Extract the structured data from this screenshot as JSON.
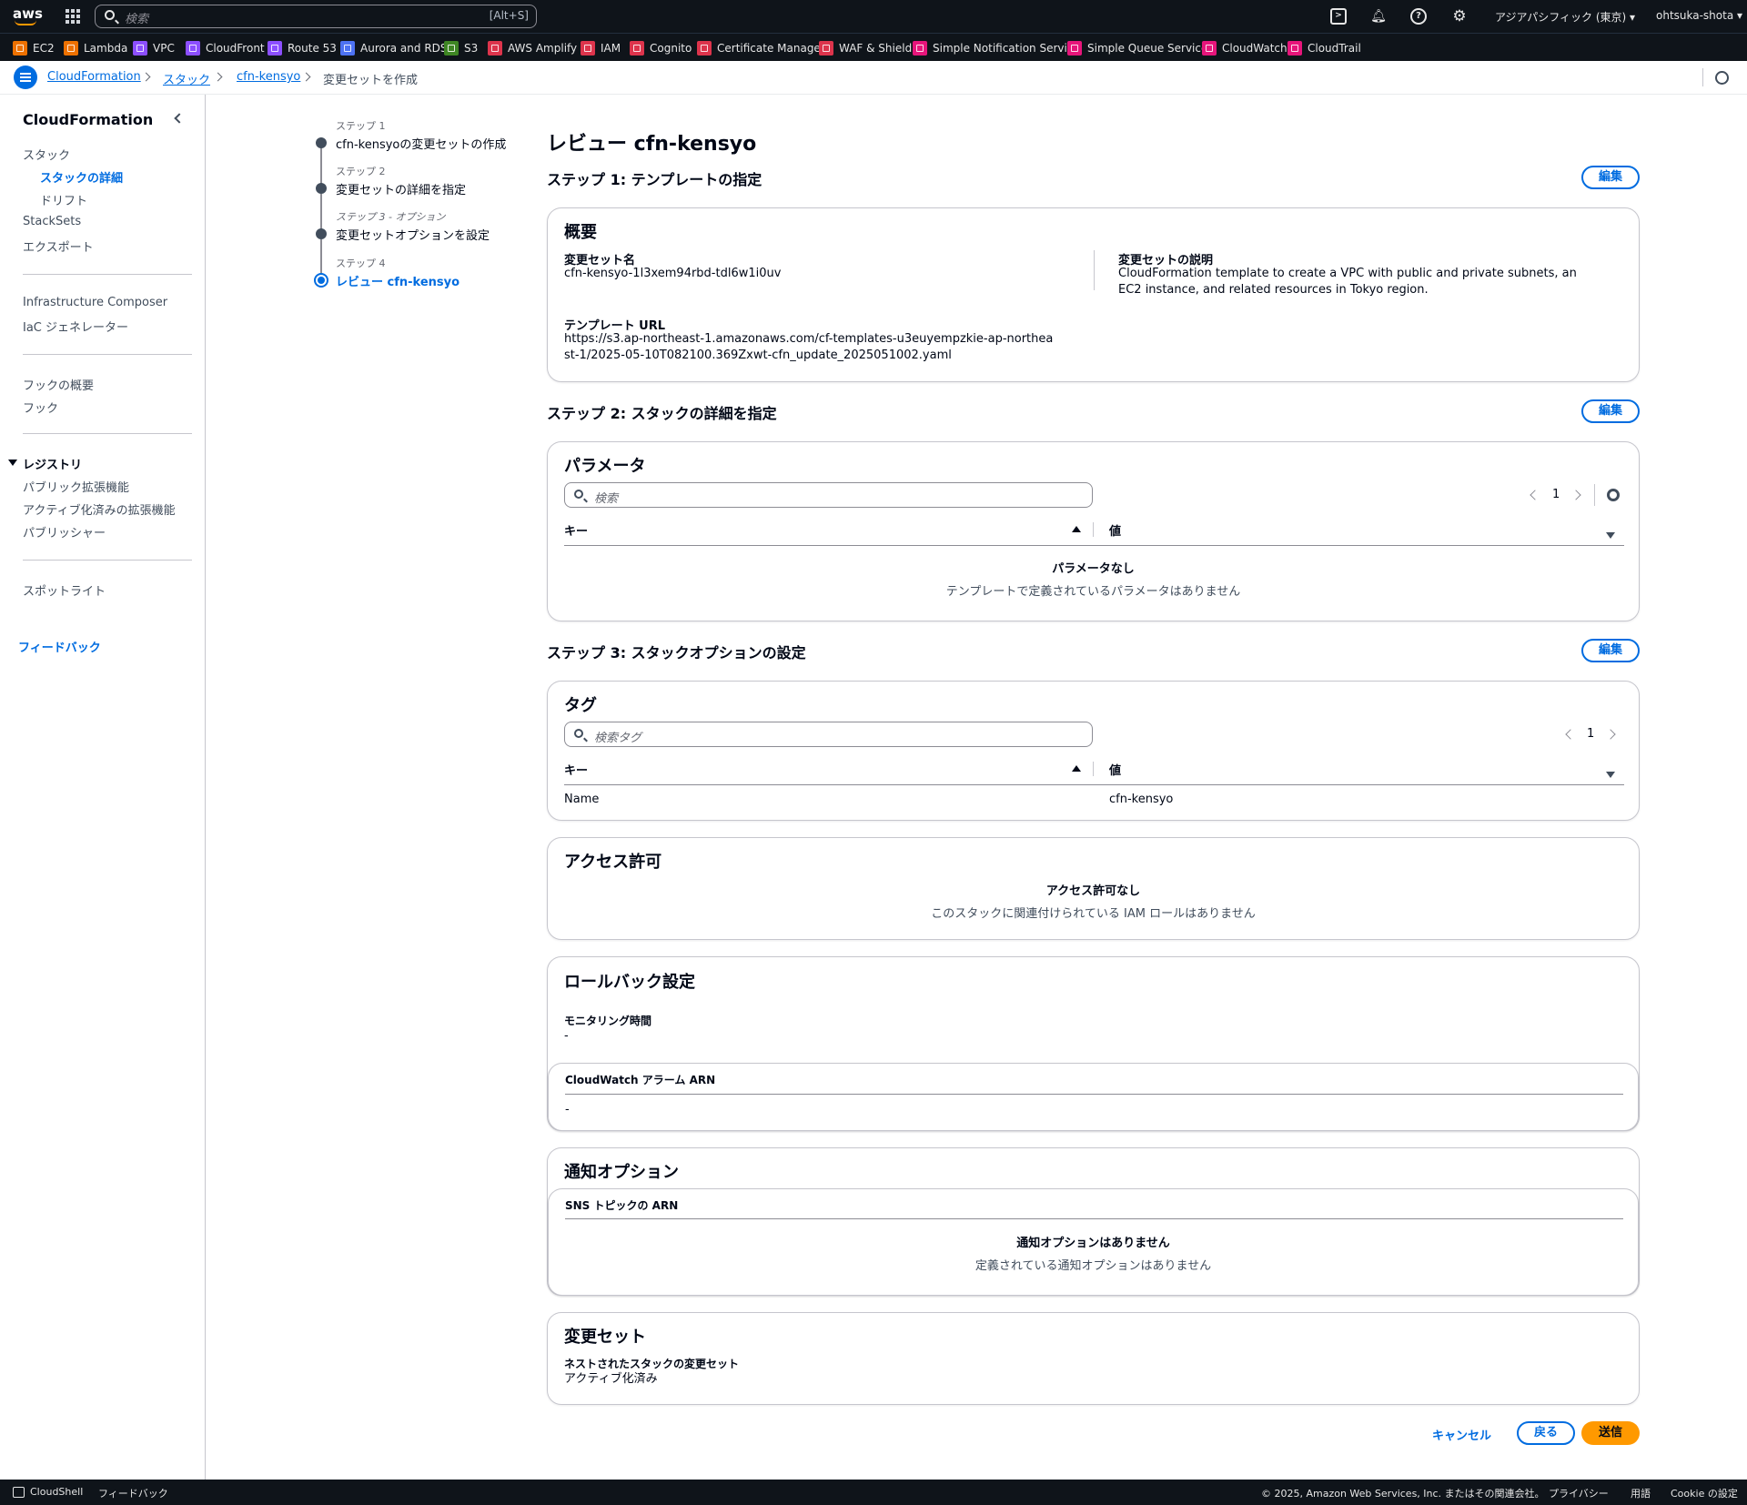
{
  "topnav": {
    "logo": "aws",
    "search_placeholder": "検索",
    "search_shortcut": "[Alt+S]",
    "region": "アジアパシフィック (東京) ▾",
    "user": "ohtsuka-shota ▾",
    "icons": [
      "apps-grid-icon",
      "cloudshell-icon",
      "bell-icon",
      "help-icon",
      "settings-icon"
    ]
  },
  "favorites": [
    {
      "label": "EC2",
      "color": "#ed7100"
    },
    {
      "label": "Lambda",
      "color": "#ed7100"
    },
    {
      "label": "VPC",
      "color": "#8c4fff"
    },
    {
      "label": "CloudFront",
      "color": "#8c4fff"
    },
    {
      "label": "Route 53",
      "color": "#8c4fff"
    },
    {
      "label": "Aurora and RDS",
      "color": "#4d72f3"
    },
    {
      "label": "S3",
      "color": "#3f8624"
    },
    {
      "label": "AWS Amplify",
      "color": "#dd344c"
    },
    {
      "label": "IAM",
      "color": "#dd344c"
    },
    {
      "label": "Cognito",
      "color": "#dd344c"
    },
    {
      "label": "Certificate Manager",
      "color": "#dd344c"
    },
    {
      "label": "WAF & Shield",
      "color": "#dd344c"
    },
    {
      "label": "Simple Notification Service",
      "color": "#e7157b"
    },
    {
      "label": "Simple Queue Service",
      "color": "#e7157b"
    },
    {
      "label": "CloudWatch",
      "color": "#e7157b"
    },
    {
      "label": "CloudTrail",
      "color": "#e7157b"
    }
  ],
  "breadcrumb": {
    "items": [
      "CloudFormation",
      "スタック",
      "cfn-kensyo"
    ],
    "current": "変更セットを作成"
  },
  "sidenav": {
    "title": "CloudFormation",
    "stacks": "スタック",
    "stack_details": "スタックの詳細",
    "drift": "ドリフト",
    "stacksets": "StackSets",
    "exports": "エクスポート",
    "infra_composer": "Infrastructure Composer",
    "iac_generator": "IaC ジェネレーター",
    "hooks_overview": "フックの概要",
    "hooks": "フック",
    "registry": "レジストリ",
    "public_extensions": "パブリック拡張機能",
    "activated_extensions": "アクティブ化済みの拡張機能",
    "publishers": "パブリッシャー",
    "spotlight": "スポットライト",
    "feedback": "フィードバック"
  },
  "wizard": [
    {
      "label": "ステップ 1",
      "title": "cfn-kensyoの変更セットの作成"
    },
    {
      "label": "ステップ 2",
      "title": "変更セットの詳細を指定"
    },
    {
      "label": "ステップ 3 - オプション",
      "title": "変更セットオプションを設定"
    },
    {
      "label": "ステップ 4",
      "title": "レビュー cfn-kensyo"
    }
  ],
  "main": {
    "title": "レビュー cfn-kensyo",
    "edit_label": "編集",
    "step1": {
      "heading": "ステップ 1: テンプレートの指定",
      "card_title": "概要",
      "changeset_name_key": "変更セット名",
      "changeset_name": "cfn-kensyo-1l3xem94rbd-tdl6w1i0uv",
      "description_key": "変更セットの説明",
      "description": "CloudFormation template to create a VPC with public and private subnets, an EC2 instance, and related resources in Tokyo region.",
      "template_url_key": "テンプレート URL",
      "template_url": "https://s3.ap-northeast-1.amazonaws.com/cf-templates-u3euyempzkie-ap-northeast-1/2025-05-10T082100.369Zxwt-cfn_update_2025051002.yaml"
    },
    "step2": {
      "heading": "ステップ 2: スタックの詳細を指定",
      "card_title": "パラメータ",
      "search_placeholder": "検索",
      "page": "1",
      "col_key": "キー",
      "col_value": "値",
      "empty_title": "パラメータなし",
      "empty_desc": "テンプレートで定義されているパラメータはありません"
    },
    "step3": {
      "heading": "ステップ 3: スタックオプションの設定",
      "tags_title": "タグ",
      "tags_search_placeholder": "検索タグ",
      "page": "1",
      "col_key": "キー",
      "col_value": "値",
      "tags": [
        {
          "key": "Name",
          "value": "cfn-kensyo"
        }
      ],
      "permissions_title": "アクセス許可",
      "permissions_empty_title": "アクセス許可なし",
      "permissions_empty_desc": "このスタックに関連付けられている IAM ロールはありません",
      "rollback_title": "ロールバック設定",
      "monitoring_key": "モニタリング時間",
      "monitoring_value": "-",
      "alarm_arn_header": "CloudWatch アラーム ARN",
      "alarm_arn_value": "-",
      "notification_title": "通知オプション",
      "sns_header": "SNS トピックの ARN",
      "notification_empty_title": "通知オプションはありません",
      "notification_empty_desc": "定義されている通知オプションはありません",
      "changeset_title": "変更セット",
      "nested_key": "ネストされたスタックの変更セット",
      "nested_value": "アクティブ化済み"
    },
    "actions": {
      "cancel": "キャンセル",
      "back": "戻る",
      "submit": "送信"
    }
  },
  "footer": {
    "cloudshell": "CloudShell",
    "feedback": "フィードバック",
    "copyright": "© 2025, Amazon Web Services, Inc. またはその関連会社。",
    "privacy": "プライバシー",
    "terms": "用語",
    "cookie": "Cookie の設定"
  },
  "colors": {
    "nav_bg": "#0f141a",
    "link": "#006ce0",
    "primary_button": "#ff9900",
    "border": "#c6c6cd"
  }
}
